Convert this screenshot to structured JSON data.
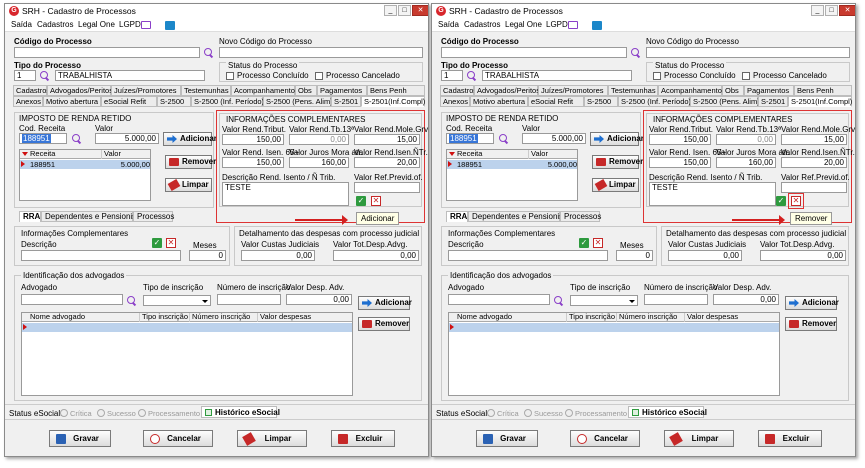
{
  "app": {
    "title": "SRH - Cadastro de Processos"
  },
  "menu": {
    "items": [
      "Saída",
      "Cadastros",
      "Legal One",
      "LGPD"
    ]
  },
  "header": {
    "codigo_label": "Código do Processo",
    "novo_codigo_label": "Novo Código do Processo",
    "tipo_label": "Tipo do Processo",
    "tipo_code": "1",
    "tipo_name": "TRABALHISTA",
    "status_label": "Status do Processo",
    "status_concluido": "Processo Concluído",
    "status_cancelado": "Processo Cancelado"
  },
  "tabs_row1": [
    "Cadastros",
    "Advogados/Peritos",
    "Juízes/Promotores",
    "Testemunhas",
    "Acompanhamento",
    "Obs",
    "Pagamentos",
    "Bens Penh"
  ],
  "tabs_row2": [
    "Anexos",
    "Motivo abertura",
    "eSocial Refit",
    "S-2500",
    "S-2500 (Inf. Período)",
    "S-2500 (Pens. Alim)",
    "S-2501",
    "S-2501(Inf.Compl)"
  ],
  "irr": {
    "title": "IMPOSTO DE RENDA RETIDO",
    "cod_label": "Cod. Receita",
    "valor_label": "Valor",
    "cod_value": "188951",
    "valor_value": "5.000,00",
    "grid_headers": [
      "Receita",
      "Valor"
    ],
    "grid_row": {
      "receita": "188951",
      "valor": "5.000,00"
    },
    "btn_adicionar": "Adicionar",
    "btn_remover": "Remover",
    "btn_limpar": "Limpar"
  },
  "info": {
    "title": "INFORMAÇÕES COMPLEMENTARES",
    "f1_label": "Valor Rend.Tribut.",
    "f1_value": "150,00",
    "f2_label": "Valor Rend.Tb.13ª",
    "f2_value": "0,00",
    "f3_label": "Valor Rend.Mole.Grv.",
    "f3_value": "15,00",
    "f4_label": "Valor Rend. Isen. 65+",
    "f4_value": "150,00",
    "f5_label": "Valor Juros Mora atr.",
    "f5_value": "160,00",
    "f6_label": "Valor Rend.Isen.ÑTr.",
    "f6_value": "20,00",
    "desc_label": "Descrição Rend. Isento / Ñ Trib.",
    "desc_value": "TESTE",
    "refprev_label": "Valor Ref.Previd.of.",
    "refprev_value": ""
  },
  "tooltips": {
    "left": "Adicionar",
    "right": "Remover"
  },
  "subtabs": [
    "RRA",
    "Dependentes e Pensionistas",
    "Processos"
  ],
  "rra": {
    "info_title": "Informações Complementares",
    "descricao_label": "Descrição",
    "meses_label": "Meses",
    "meses_value": "0",
    "det_title": "Detalhamento das despesas com processo judicial",
    "custas_label": "Valor Custas Judiciais",
    "custas_value": "0,00",
    "desp_label": "Valor Tot.Desp.Advg.",
    "desp_value": "0,00"
  },
  "adv": {
    "title": "Identificação dos advogados",
    "adv_label": "Advogado",
    "tipo_label": "Tipo de inscrição",
    "num_label": "Número de inscrição",
    "valor_label": "Valor Desp. Adv.",
    "valor_value": "0,00",
    "grid_headers": [
      "Nome advogado",
      "Tipo inscrição",
      "Número inscrição",
      "Valor despesas"
    ],
    "btn_adicionar": "Adicionar",
    "btn_remover": "Remover"
  },
  "status_bar": {
    "label": "Status eSocial:",
    "items": [
      "Crítica",
      "Sucesso",
      "Processamento"
    ],
    "historico": "Histórico eSocial"
  },
  "footer": {
    "gravar": "Gravar",
    "cancelar": "Cancelar",
    "limpar": "Limpar",
    "excluir": "Excluir"
  }
}
